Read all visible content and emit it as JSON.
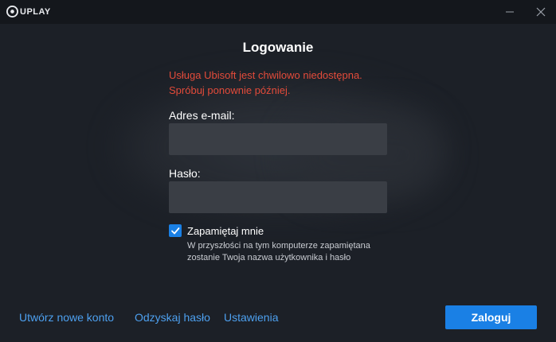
{
  "app": {
    "logo_text": "UPLAY"
  },
  "login": {
    "title": "Logowanie",
    "error_line1": "Usługa Ubisoft jest chwilowo niedostępna.",
    "error_line2": "Spróbuj ponownie później.",
    "email_label": "Adres e-mail:",
    "email_value": "",
    "password_label": "Hasło:",
    "password_value": "",
    "remember_label": "Zapamiętaj mnie",
    "remember_checked": true,
    "remember_desc_line1": "W przyszłości na tym komputerze zapamiętana",
    "remember_desc_line2": "zostanie Twoja nazwa użytkownika i hasło",
    "submit_label": "Zaloguj"
  },
  "footer": {
    "create_account": "Utwórz nowe konto",
    "recover_password": "Odzyskaj hasło",
    "settings": "Ustawienia"
  },
  "colors": {
    "background": "#1c2027",
    "titlebar": "#14171c",
    "error": "#e34b3a",
    "accent": "#1a80e5",
    "link": "#4da0ef",
    "input_bg": "#3a3e45"
  },
  "icons": {
    "logo": "uplay-logo-icon",
    "minimize": "minimize-icon",
    "close": "close-icon",
    "checkmark": "checkmark-icon"
  }
}
